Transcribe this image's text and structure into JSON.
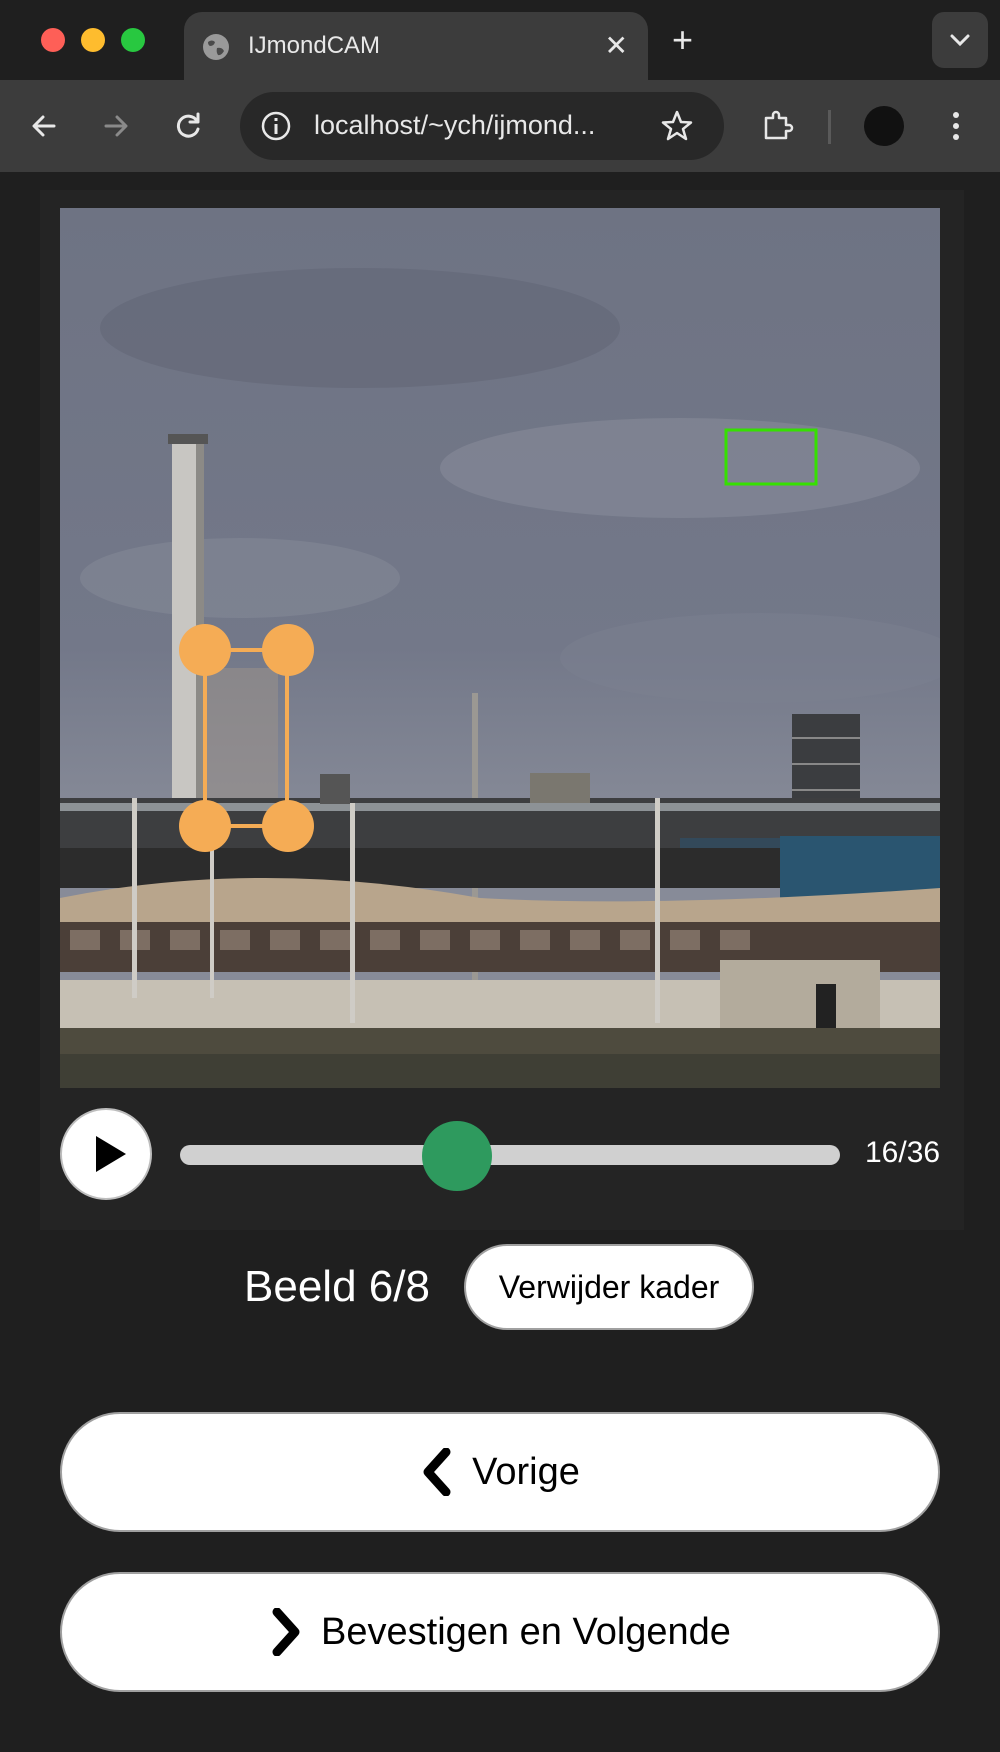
{
  "browser": {
    "tab_title": "IJmondCAM",
    "url": "localhost/~ych/ijmond...",
    "new_tab_label": "+",
    "close_label": "✕"
  },
  "icons": {
    "tab": "globe-icon",
    "back": "back-arrow-icon",
    "forward": "forward-arrow-icon",
    "reload": "reload-icon",
    "site_info": "info-icon",
    "bookmark": "star-icon",
    "extensions": "puzzle-icon",
    "menu": "more-vert-icon",
    "tab_search": "chevron-down-icon",
    "play": "play-icon",
    "prev": "chevron-left-icon",
    "next": "chevron-right-icon"
  },
  "colors": {
    "annotation_box": "#f5ac55",
    "detection_box": "#35e000",
    "slider_thumb": "#2e9a5e"
  },
  "player": {
    "current_frame": 16,
    "total_frames": 36,
    "frame_label": "16/36",
    "progress_fraction": 0.42
  },
  "annotation": {
    "frame_label": "Beeld 6/8",
    "remove_button": "Verwijder kader"
  },
  "navigation": {
    "prev_label": "Vorige",
    "next_label": "Bevestigen en Volgende"
  }
}
